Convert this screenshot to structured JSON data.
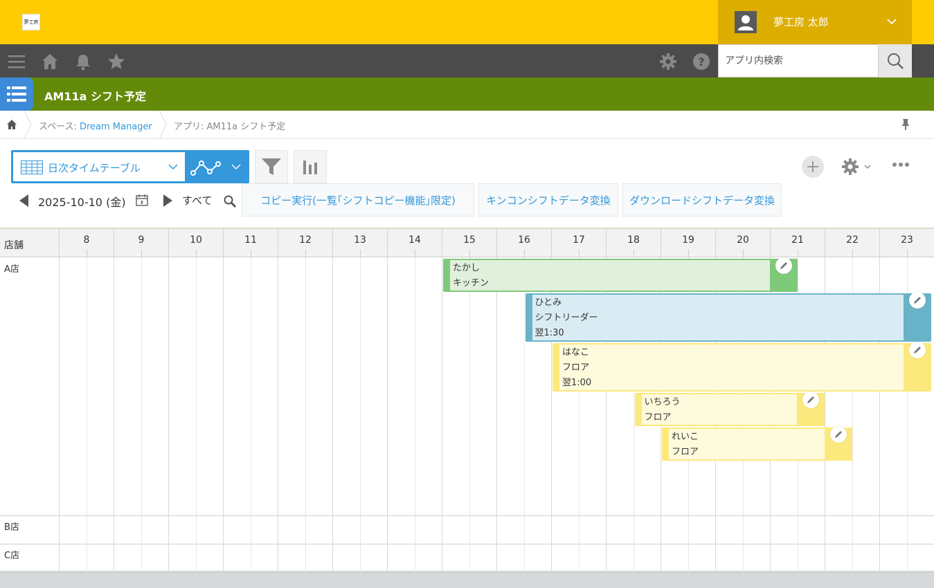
{
  "header": {
    "user_name": "夢工房 太郎",
    "logo_text": "夢工房"
  },
  "search": {
    "placeholder": "アプリ内検索"
  },
  "app": {
    "title": "AM11a シフト予定"
  },
  "breadcrumb": {
    "space_prefix": "スペース: ",
    "space_name": "Dream Manager",
    "app_label": "アプリ: AM11a シフト予定"
  },
  "toolbar": {
    "view_name": "日次タイムテーブル",
    "date": "2025-10-10 (金)",
    "filter_all": "すべて",
    "actions": [
      "コピー実行(一覧｢シフトコピー機能｣限定)",
      "キンコンシフトデータ変換",
      "ダウンロードシフトデータ変換"
    ]
  },
  "timetable": {
    "store_header": "店舗",
    "hours": [
      "8",
      "9",
      "10",
      "11",
      "12",
      "13",
      "14",
      "15",
      "16",
      "17",
      "18",
      "19",
      "20",
      "21",
      "22",
      "23"
    ],
    "stores": [
      "A店",
      "B店",
      "C店"
    ],
    "shifts": [
      {
        "name": "たかし",
        "role": "キッチン",
        "note": "",
        "start": 15.0,
        "end": 21.5,
        "color": "#7fc97a",
        "store": "A店"
      },
      {
        "name": "ひとみ",
        "role": "シフトリーダー",
        "note": "翌1:30",
        "start": 16.5,
        "end": 25.5,
        "color": "#69b3c8",
        "store": "A店"
      },
      {
        "name": "はなこ",
        "role": "フロア",
        "note": "翌1:00",
        "start": 17.0,
        "end": 25.0,
        "color": "#fce97d",
        "store": "A店"
      },
      {
        "name": "いちろう",
        "role": "フロア",
        "note": "",
        "start": 18.5,
        "end": 22.0,
        "color": "#fce97d",
        "store": "A店"
      },
      {
        "name": "れいこ",
        "role": "フロア",
        "note": "",
        "start": 19.0,
        "end": 22.5,
        "color": "#fce97d",
        "store": "A店"
      }
    ]
  },
  "colors": {
    "header": "#fecc00",
    "nav": "#4b4b4b",
    "appbar": "#648a0a",
    "accent": "#3498db"
  }
}
